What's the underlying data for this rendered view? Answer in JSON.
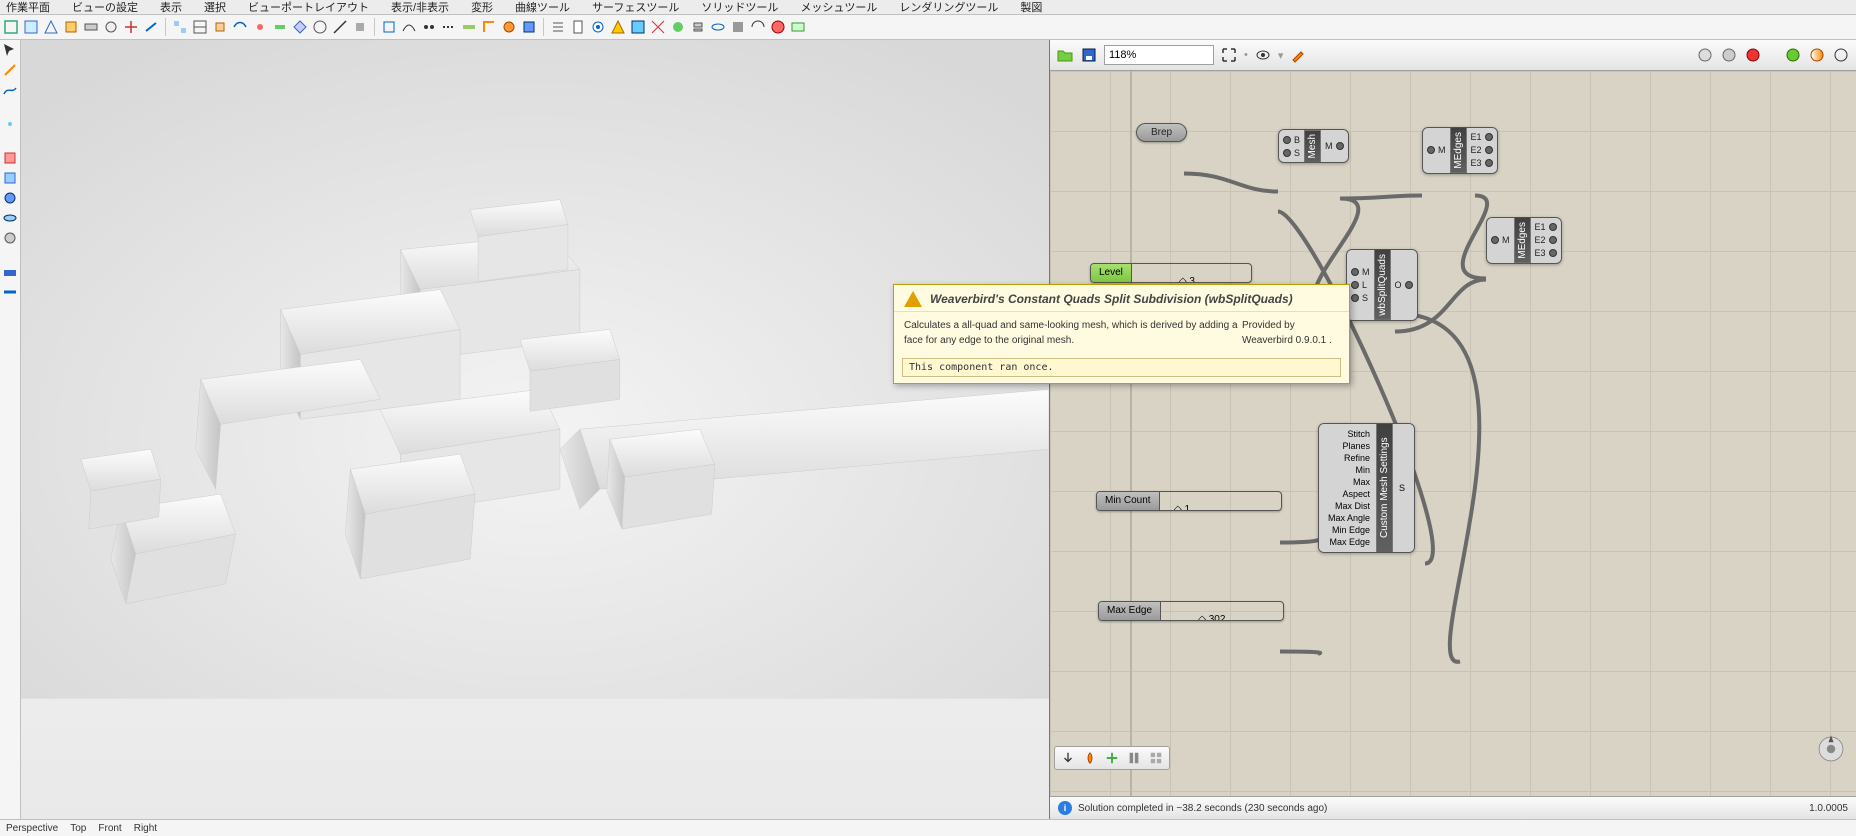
{
  "menubar": {
    "items": [
      "作業平面",
      "ビューの設定",
      "表示",
      "選択",
      "ビューポートレイアウト",
      "表示/非表示",
      "変形",
      "曲線ツール",
      "サーフェスツール",
      "ソリッドツール",
      "メッシュツール",
      "レンダリングツール",
      "製図"
    ]
  },
  "viewport": {
    "label": "Perspective"
  },
  "bottom_tabs": [
    "Perspective",
    "Top",
    "Front",
    "Right"
  ],
  "gh": {
    "zoom": "118%",
    "params": {
      "brep": "Brep"
    },
    "sliders": {
      "level": {
        "label": "Level",
        "value": "◇ 3"
      },
      "min_count": {
        "label": "Min Count",
        "value": "◇ 1"
      },
      "max_edge": {
        "label": "Max Edge",
        "value": "◇ 302"
      }
    },
    "components": {
      "mesh": {
        "title": "Mesh",
        "inputs": [
          "B",
          "S"
        ],
        "outputs": [
          "M"
        ]
      },
      "medges1": {
        "title": "MEdges",
        "inputs": [
          "M"
        ],
        "outputs": [
          "E1",
          "E2",
          "E3"
        ]
      },
      "medges2": {
        "title": "MEdges",
        "inputs": [
          "M"
        ],
        "outputs": [
          "E1",
          "E2",
          "E3"
        ]
      },
      "split": {
        "title": "wbSplitQuads",
        "inputs": [
          "M",
          "L",
          "S"
        ],
        "outputs": [
          "O"
        ]
      },
      "cms": {
        "title": "Custom Mesh Settings",
        "inputs": [
          "Stitch",
          "Planes",
          "Refine",
          "Min",
          "Max",
          "Aspect",
          "Max Dist",
          "Max Angle",
          "Min Edge",
          "Max Edge"
        ],
        "outputs": [
          "S"
        ]
      }
    },
    "tooltip": {
      "title": "Weaverbird's Constant Quads Split Subdivision (wbSplitQuads)",
      "line1": "Calculates a all-quad and same-looking mesh, which is derived by adding a face for any edge to the original mesh.",
      "line2": "Provided by Weaverbird 0.9.0.1 .",
      "status": "This component ran once."
    },
    "status": {
      "text": "Solution completed in ~38.2 seconds (230 seconds ago)",
      "version": "1.0.0005"
    }
  }
}
